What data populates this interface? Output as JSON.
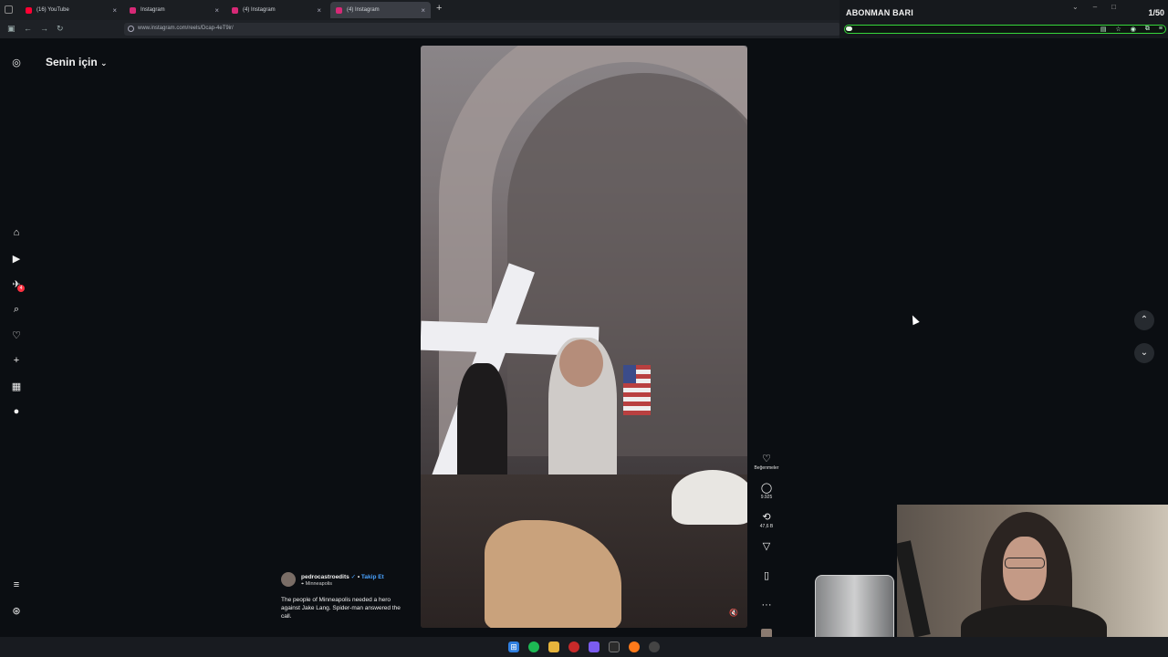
{
  "browser": {
    "tabs": [
      {
        "label": "(16) YouTube",
        "favicon_color": "#ff0033",
        "active": false
      },
      {
        "label": "Instagram",
        "favicon_color": "#d62976",
        "active": false
      },
      {
        "label": "(4) Instagram",
        "favicon_color": "#d62976",
        "active": false
      },
      {
        "label": "(4) Instagram",
        "favicon_color": "#d62976",
        "active": true
      }
    ],
    "new_tab": "+",
    "url": "www.instagram.com/reels/Dcap-4eT9ir/"
  },
  "subscriber_bar": {
    "title": "ABONMAN BARI",
    "count": "1/50",
    "progress_fraction": 0.02,
    "accent": "#36d63a"
  },
  "instagram": {
    "feed_title": "Senin için",
    "badges": {
      "messages": "4"
    },
    "actions": {
      "like_label": "Beğenmeler",
      "comment_count": "9.925",
      "repost_count": "47,6 B"
    },
    "caption": {
      "username": "pedrocastroedits",
      "follow_label": "Takip Et",
      "location": "Minneapolis",
      "text": "The people of Minneapolis needed a hero against Jake Lang. Spider-man answered the call."
    }
  },
  "colors": {
    "background": "#0b0e12",
    "link_blue": "#4aa3ff",
    "notification_red": "#ff3040"
  }
}
